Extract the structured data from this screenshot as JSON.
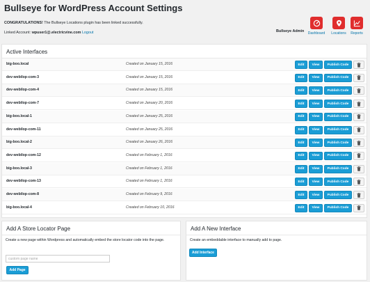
{
  "page": {
    "title": "Bullseye for WordPress Account Settings"
  },
  "notice": {
    "strong": "CONGRATULATIONS!",
    "text": " The Bullseye Locations plugin has been linked successfully."
  },
  "account": {
    "label": "Linked Account: ",
    "email": "wpuser1@.electricvine.com",
    "logout": "Logout",
    "admin_name": "Bullseye Admin"
  },
  "top_actions": [
    {
      "label": "Dashboard",
      "icon": "speedometer-icon",
      "color": "#e02d2d"
    },
    {
      "label": "Locations",
      "icon": "map-pin-icon",
      "color": "#e02d2d"
    },
    {
      "label": "Reports",
      "icon": "line-chart-icon",
      "color": "#e02d2d"
    }
  ],
  "active_interfaces": {
    "heading": "Active Interfaces",
    "buttons": {
      "edit": "Edit",
      "view": "View",
      "publish": "Publish Code",
      "trash_icon": "trash-icon"
    },
    "rows": [
      {
        "name": "big-boo.local",
        "created": "Created on January 15, 2016"
      },
      {
        "name": "dev-webilop-com-3",
        "created": "Created on January 15, 2016"
      },
      {
        "name": "dev-webilop-com-4",
        "created": "Created on January 15, 2016"
      },
      {
        "name": "dev-webilop-com-7",
        "created": "Created on January 20, 2016"
      },
      {
        "name": "big-boo.local-1",
        "created": "Created on January 25, 2016"
      },
      {
        "name": "dev-webilop-com-11",
        "created": "Created on January 25, 2016"
      },
      {
        "name": "big-boo.local-2",
        "created": "Created on January 26, 2016"
      },
      {
        "name": "dev-webilop-com-12",
        "created": "Created on February 1, 2016"
      },
      {
        "name": "big-boo.local-3",
        "created": "Created on February 1, 2016"
      },
      {
        "name": "dev-webilop-com-13",
        "created": "Created on February 1, 2016"
      },
      {
        "name": "dev-webilop-com-8",
        "created": "Created on February 9, 2016"
      },
      {
        "name": "big-boo.local-4",
        "created": "Created on February 10, 2016"
      }
    ]
  },
  "store_locator": {
    "heading": "Add A Store Locator Page",
    "description": "Create a new page within Wordpress and automatically embed the store locator code into the page.",
    "input_placeholder": "custom page name",
    "button": "Add Page"
  },
  "new_interface": {
    "heading": "Add A New Interface",
    "description": "Create an embeddable interface to manually add to page.",
    "button": "Add Interface"
  },
  "colors": {
    "accent": "#1a9dd6",
    "brand_red": "#e02d2d",
    "link": "#0073aa"
  }
}
